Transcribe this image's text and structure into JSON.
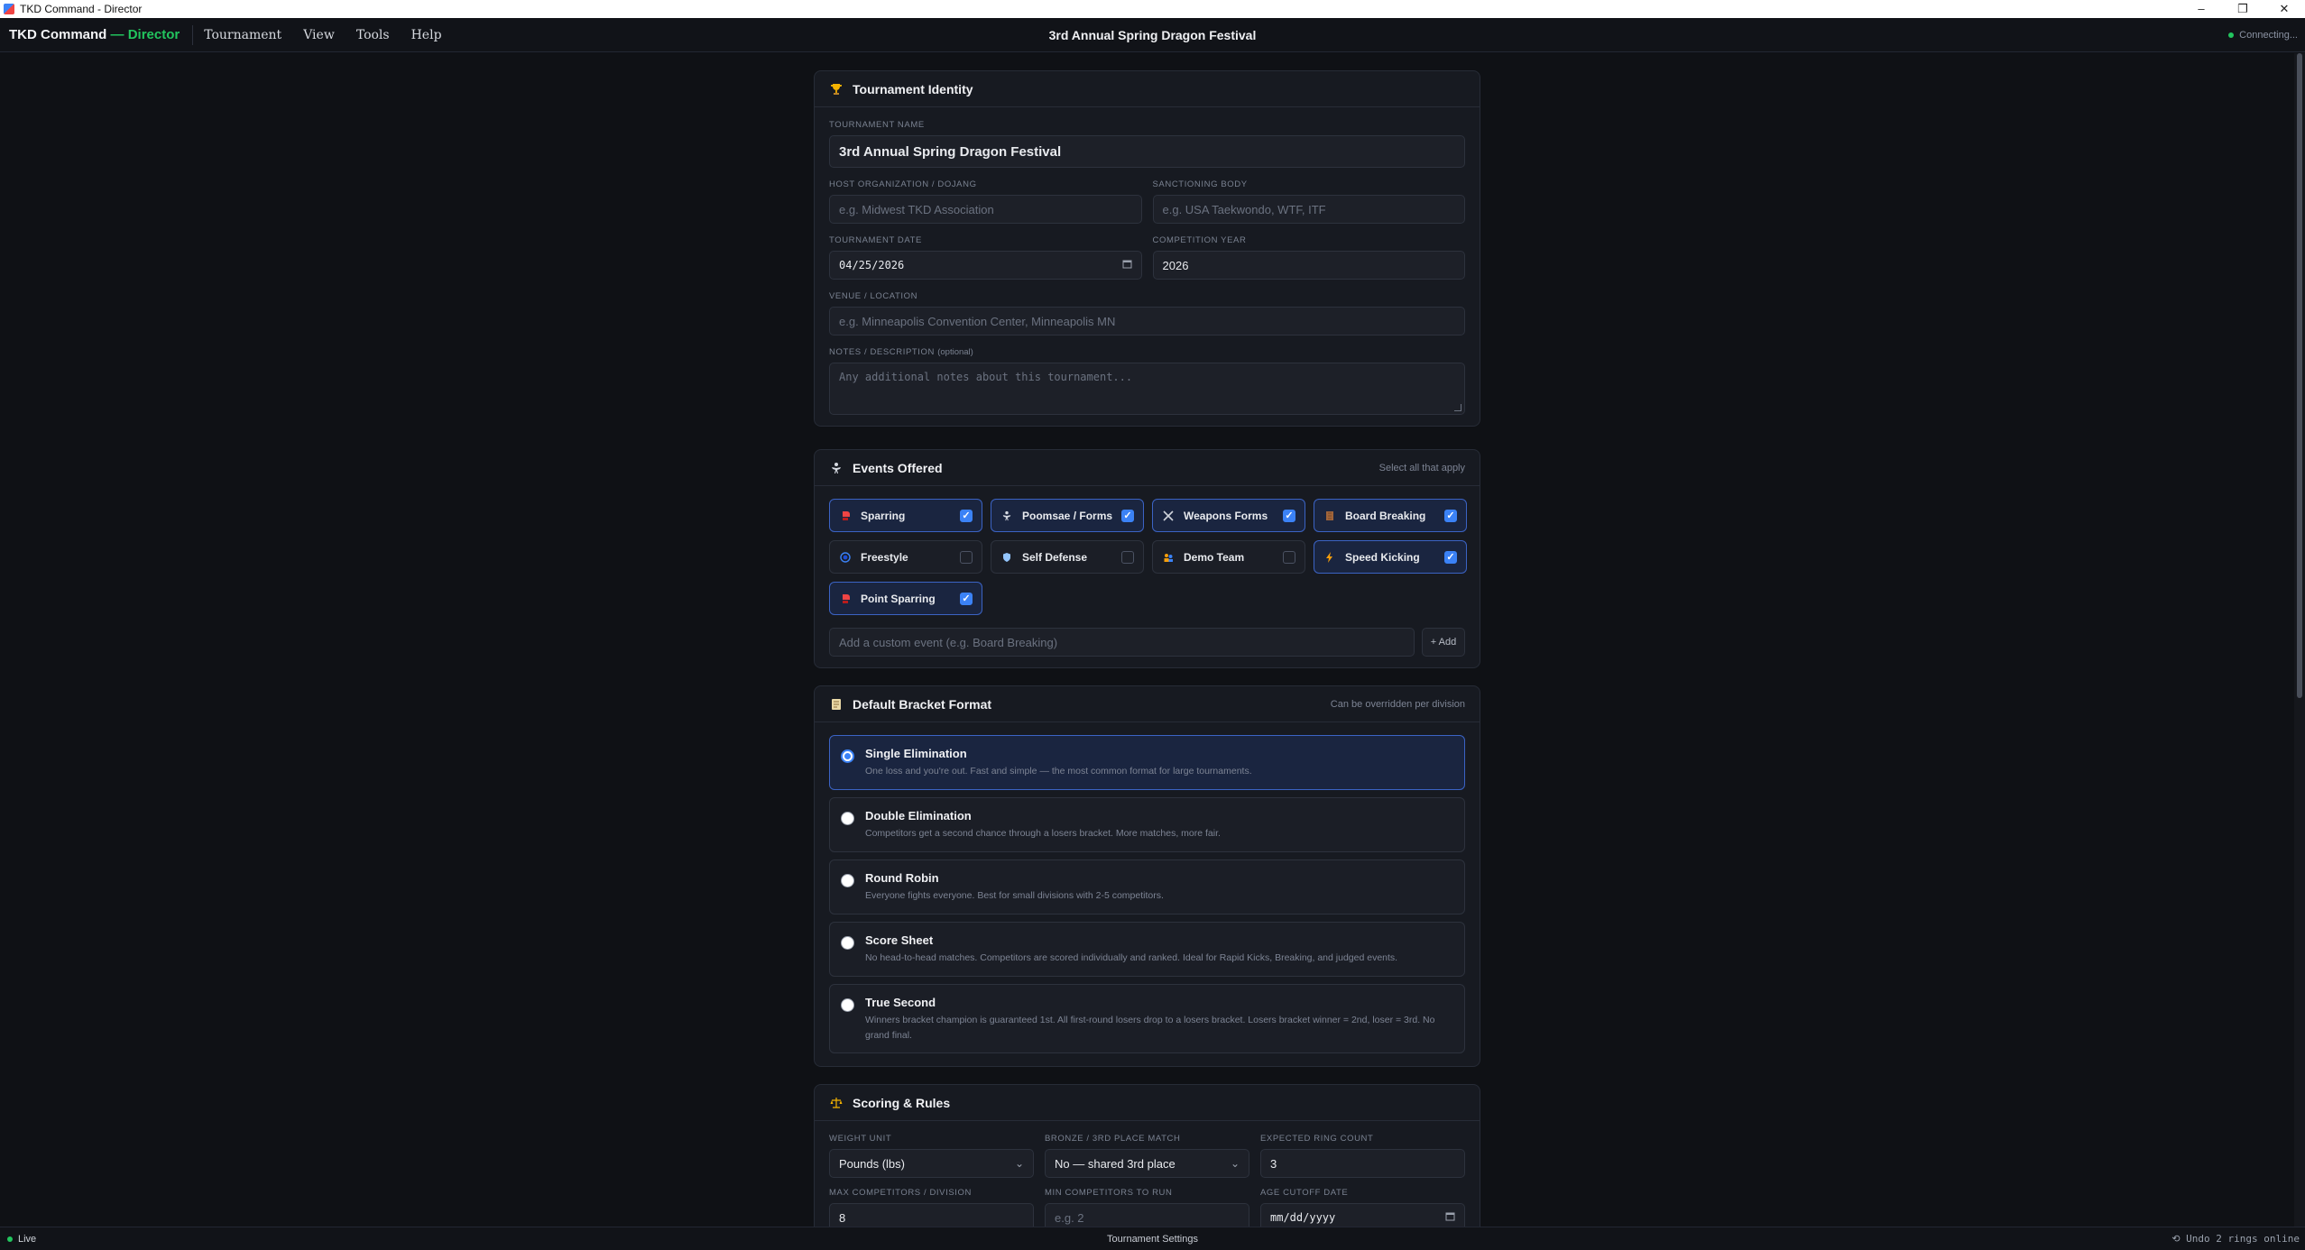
{
  "window": {
    "title": "TKD Command - Director",
    "minimize": "–",
    "maximize": "❐",
    "close": "✕"
  },
  "menubar": {
    "brand": "TKD Command",
    "brand_sep": " — ",
    "brand_role": "Director",
    "items": [
      "Tournament",
      "View",
      "Tools",
      "Help"
    ],
    "title": "3rd Annual Spring Dragon Festival",
    "status": "Connecting..."
  },
  "identity": {
    "header": "Tournament Identity",
    "icon": "trophy-icon",
    "name_label": "TOURNAMENT NAME",
    "name_value": "3rd Annual Spring Dragon Festival",
    "host_label": "HOST ORGANIZATION / DOJANG",
    "host_placeholder": "e.g. Midwest TKD Association",
    "sanction_label": "SANCTIONING BODY",
    "sanction_placeholder": "e.g. USA Taekwondo, WTF, ITF",
    "date_label": "TOURNAMENT DATE",
    "date_value": "04/25/2026",
    "year_label": "COMPETITION YEAR",
    "year_value": "2026",
    "venue_label": "VENUE / LOCATION",
    "venue_placeholder": "e.g. Minneapolis Convention Center, Minneapolis MN",
    "notes_label": "NOTES / DESCRIPTION",
    "notes_optional": "(optional)",
    "notes_placeholder": "Any additional notes about this tournament..."
  },
  "events": {
    "header": "Events Offered",
    "note": "Select all that apply",
    "items": [
      {
        "label": "Sparring",
        "checked": true,
        "icon": "boxing-glove-icon"
      },
      {
        "label": "Poomsae / Forms",
        "checked": true,
        "icon": "martial-arts-icon"
      },
      {
        "label": "Weapons Forms",
        "checked": true,
        "icon": "crossed-swords-icon"
      },
      {
        "label": "Board Breaking",
        "checked": true,
        "icon": "board-icon"
      },
      {
        "label": "Freestyle",
        "checked": false,
        "icon": "target-icon"
      },
      {
        "label": "Self Defense",
        "checked": false,
        "icon": "shield-icon"
      },
      {
        "label": "Demo Team",
        "checked": false,
        "icon": "team-icon"
      },
      {
        "label": "Speed Kicking",
        "checked": true,
        "icon": "lightning-icon"
      },
      {
        "label": "Point Sparring",
        "checked": true,
        "icon": "boxing-glove-icon"
      }
    ],
    "custom_placeholder": "Add a custom event (e.g. Board Breaking)",
    "add_label": "+ Add"
  },
  "bracket": {
    "header": "Default Bracket Format",
    "note": "Can be overridden per division",
    "options": [
      {
        "title": "Single Elimination",
        "desc": "One loss and you're out. Fast and simple — the most common format for large tournaments.",
        "selected": true
      },
      {
        "title": "Double Elimination",
        "desc": "Competitors get a second chance through a losers bracket. More matches, more fair.",
        "selected": false
      },
      {
        "title": "Round Robin",
        "desc": "Everyone fights everyone. Best for small divisions with 2-5 competitors.",
        "selected": false
      },
      {
        "title": "Score Sheet",
        "desc": "No head-to-head matches. Competitors are scored individually and ranked. Ideal for Rapid Kicks, Breaking, and judged events.",
        "selected": false
      },
      {
        "title": "True Second",
        "desc": "Winners bracket champion is guaranteed 1st. All first-round losers drop to a losers bracket. Losers bracket winner = 2nd, loser = 3rd. No grand final.",
        "selected": false
      }
    ]
  },
  "scoring": {
    "header": "Scoring & Rules",
    "weight_label": "WEIGHT UNIT",
    "weight_value": "Pounds (lbs)",
    "bronze_label": "BRONZE / 3RD PLACE MATCH",
    "bronze_value": "No — shared 3rd place",
    "rings_label": "EXPECTED RING COUNT",
    "rings_value": "3",
    "max_label": "MAX COMPETITORS / DIVISION",
    "max_value": "8",
    "min_label": "MIN COMPETITORS TO RUN",
    "min_placeholder": "e.g. 2",
    "cutoff_label": "AGE CUTOFF DATE",
    "cutoff_value": "mm/dd/yyyy"
  },
  "statusbar": {
    "live": "Live",
    "center": "Tournament Settings",
    "right": "⟲ Undo  2 rings online"
  },
  "colors": {
    "accent": "#3b82f6",
    "live": "#22c55e",
    "background": "#0f1115",
    "card": "#171a21"
  }
}
